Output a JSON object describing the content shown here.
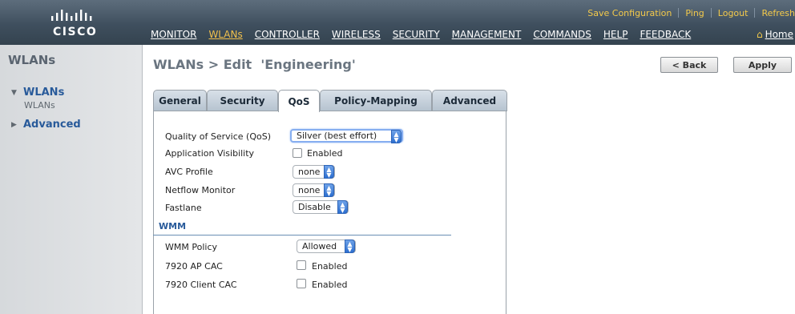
{
  "header": {
    "logo_text": "CISCO",
    "utility_links": [
      "Save Configuration",
      "Ping",
      "Logout",
      "Refresh"
    ],
    "nav_items": [
      "MONITOR",
      "WLANs",
      "CONTROLLER",
      "WIRELESS",
      "SECURITY",
      "MANAGEMENT",
      "COMMANDS",
      "HELP",
      "FEEDBACK"
    ],
    "active_nav": "WLANs",
    "home_label": "Home",
    "home_icon": "home-icon"
  },
  "sidebar": {
    "title": "WLANs",
    "groups": [
      {
        "label": "WLANs",
        "expanded": true,
        "children": [
          "WLANs"
        ]
      },
      {
        "label": "Advanced",
        "expanded": false,
        "children": []
      }
    ]
  },
  "page": {
    "title": "WLANs > Edit  'Engineering'",
    "back_label": "< Back",
    "apply_label": "Apply"
  },
  "tabs": [
    {
      "label": "General",
      "active": false
    },
    {
      "label": "Security",
      "active": false
    },
    {
      "label": "QoS",
      "active": true
    },
    {
      "label": "Policy-Mapping",
      "active": false
    },
    {
      "label": "Advanced",
      "active": false
    }
  ],
  "qos": {
    "quality_label": "Quality of Service (QoS)",
    "quality_value": "Silver (best effort)",
    "app_visibility_label": "Application Visibility",
    "app_visibility_checkbox": "Enabled",
    "app_visibility_checked": false,
    "avc_profile_label": "AVC Profile",
    "avc_profile_value": "none",
    "netflow_label": "Netflow Monitor",
    "netflow_value": "none",
    "fastlane_label": "Fastlane",
    "fastlane_value": "Disable"
  },
  "wmm": {
    "section_title": "WMM",
    "policy_label": "WMM Policy",
    "policy_value": "Allowed",
    "ap_cac_label": "7920 AP CAC",
    "ap_cac_checkbox": "Enabled",
    "ap_cac_checked": false,
    "client_cac_label": "7920 Client CAC",
    "client_cac_checkbox": "Enabled",
    "client_cac_checked": false
  },
  "colors": {
    "header_bg": "#3f4f5e",
    "accent_yellow": "#f1c04c",
    "link_blue": "#285a9a",
    "select_blue": "#2d6fd0"
  }
}
